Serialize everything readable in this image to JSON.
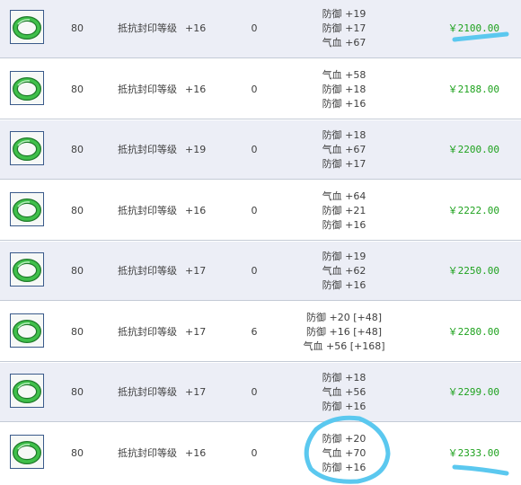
{
  "rows": [
    {
      "level": "80",
      "attr": "抵抗封印等级",
      "bonus": "+16",
      "extra": "0",
      "stats": [
        "防御 +19",
        "防御 +17",
        "气血 +67"
      ],
      "price": "￥2100.00"
    },
    {
      "level": "80",
      "attr": "抵抗封印等级",
      "bonus": "+16",
      "extra": "0",
      "stats": [
        "气血 +58",
        "防御 +18",
        "防御 +16"
      ],
      "price": "￥2188.00"
    },
    {
      "level": "80",
      "attr": "抵抗封印等级",
      "bonus": "+19",
      "extra": "0",
      "stats": [
        "防御 +18",
        "气血 +67",
        "防御 +17"
      ],
      "price": "￥2200.00"
    },
    {
      "level": "80",
      "attr": "抵抗封印等级",
      "bonus": "+16",
      "extra": "0",
      "stats": [
        "气血 +64",
        "防御 +21",
        "防御 +16"
      ],
      "price": "￥2222.00"
    },
    {
      "level": "80",
      "attr": "抵抗封印等级",
      "bonus": "+17",
      "extra": "0",
      "stats": [
        "防御 +19",
        "气血 +62",
        "防御 +16"
      ],
      "price": "￥2250.00"
    },
    {
      "level": "80",
      "attr": "抵抗封印等级",
      "bonus": "+17",
      "extra": "6",
      "stats": [
        "防御 +20 [+48]",
        "防御 +16 [+48]",
        "气血 +56 [+168]"
      ],
      "price": "￥2280.00"
    },
    {
      "level": "80",
      "attr": "抵抗封印等级",
      "bonus": "+17",
      "extra": "0",
      "stats": [
        "防御 +18",
        "气血 +56",
        "防御 +16"
      ],
      "price": "￥2299.00"
    },
    {
      "level": "80",
      "attr": "抵抗封印等级",
      "bonus": "+16",
      "extra": "0",
      "stats": [
        "防御 +20",
        "气血 +70",
        "防御 +16"
      ],
      "price": "￥2333.00"
    }
  ],
  "icon": "green-jade-ring-icon",
  "colors": {
    "price": "#1fa21f",
    "highlight": "#5bc8ef",
    "row_alt": "#eceef6",
    "row_border": "#c4cbd6"
  }
}
